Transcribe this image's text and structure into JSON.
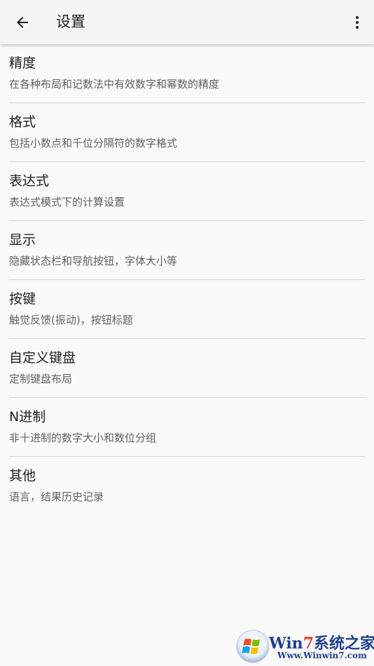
{
  "toolbar": {
    "title": "设置",
    "back_icon": "arrow-back-icon",
    "menu_icon": "more-vert-icon"
  },
  "settings": [
    {
      "title": "精度",
      "subtitle": "在各种布局和记数法中有效数字和幂数的精度"
    },
    {
      "title": "格式",
      "subtitle": "包括小数点和千位分隔符的数字格式"
    },
    {
      "title": "表达式",
      "subtitle": "表达式模式下的计算设置"
    },
    {
      "title": "显示",
      "subtitle": "隐藏状态栏和导航按钮，字体大小等"
    },
    {
      "title": "按键",
      "subtitle": "触觉反馈(振动)，按钮标题"
    },
    {
      "title": "自定义键盘",
      "subtitle": "定制键盘布局"
    },
    {
      "title": "N进制",
      "subtitle": "非十进制的数字大小和数位分组"
    },
    {
      "title": "其他",
      "subtitle": "语言，结果历史记录"
    }
  ],
  "watermark": {
    "brand_prefix": "Win",
    "brand_number": "7",
    "brand_suffix": "系统之家",
    "url": "Www.Winwin7.com"
  },
  "colors": {
    "toolbar_bg": "#f5f5f5",
    "background": "#fafafa",
    "title_text": "#212121",
    "subtitle_text": "#616161",
    "divider": "#d6d6d6"
  }
}
